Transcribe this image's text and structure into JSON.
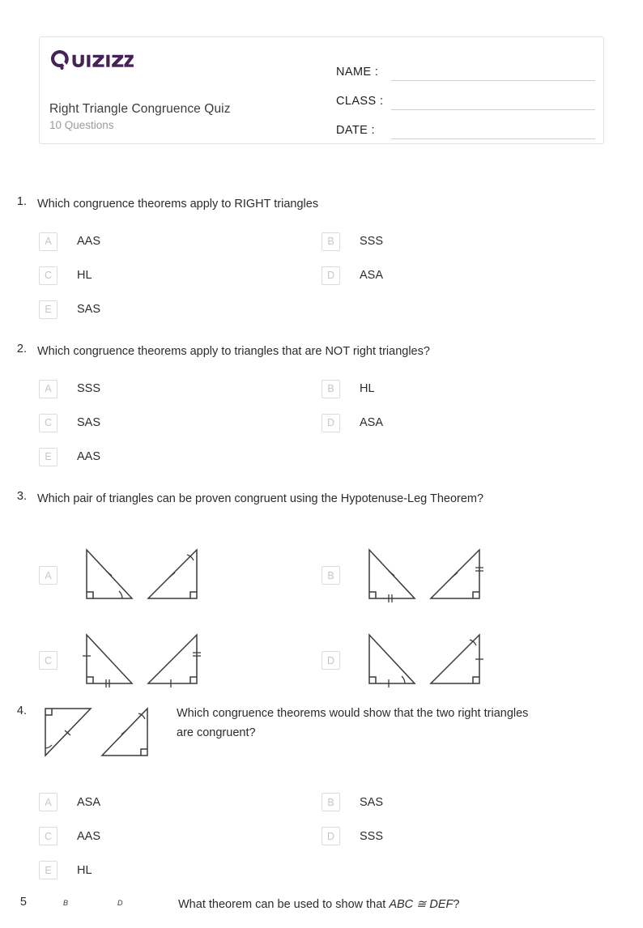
{
  "brand": {
    "name": "Quizizz",
    "color": "#462356"
  },
  "header": {
    "title": "Right Triangle Congruence Quiz",
    "subtitle": "10 Questions",
    "fields": [
      {
        "label": "NAME :"
      },
      {
        "label": "CLASS :"
      },
      {
        "label": "DATE  :"
      }
    ]
  },
  "questions": [
    {
      "number": "1.",
      "text": "Which congruence theorems apply to RIGHT triangles",
      "type": "text",
      "options": [
        {
          "letter": "A",
          "text": "AAS"
        },
        {
          "letter": "B",
          "text": "SSS"
        },
        {
          "letter": "C",
          "text": "HL"
        },
        {
          "letter": "D",
          "text": "ASA"
        },
        {
          "letter": "E",
          "text": "SAS"
        }
      ]
    },
    {
      "number": "2.",
      "text": "Which congruence theorems apply to triangles that are NOT right triangles?",
      "type": "text",
      "options": [
        {
          "letter": "A",
          "text": "SSS"
        },
        {
          "letter": "B",
          "text": "HL"
        },
        {
          "letter": "C",
          "text": "SAS"
        },
        {
          "letter": "D",
          "text": "ASA"
        },
        {
          "letter": "E",
          "text": "AAS"
        }
      ]
    },
    {
      "number": "3.",
      "text": "Which pair of triangles can be proven congruent using the Hypotenuse-Leg Theorem?",
      "type": "image",
      "options": [
        {
          "letter": "A",
          "text": ""
        },
        {
          "letter": "B",
          "text": ""
        },
        {
          "letter": "C",
          "text": ""
        },
        {
          "letter": "D",
          "text": ""
        }
      ]
    },
    {
      "number": "4.",
      "text": "Which congruence theorems would show that the two right triangles are congruent?",
      "type": "text",
      "options": [
        {
          "letter": "A",
          "text": "ASA"
        },
        {
          "letter": "B",
          "text": "SAS"
        },
        {
          "letter": "C",
          "text": "AAS"
        },
        {
          "letter": "D",
          "text": "SSS"
        },
        {
          "letter": "E",
          "text": "HL"
        }
      ]
    },
    {
      "number": "5",
      "text_prefix": "What theorem can be used to show that ",
      "text_italic": "ABC ≅ DEF",
      "text_suffix": "?",
      "type": "image",
      "labels": [
        "B",
        "D"
      ]
    }
  ]
}
